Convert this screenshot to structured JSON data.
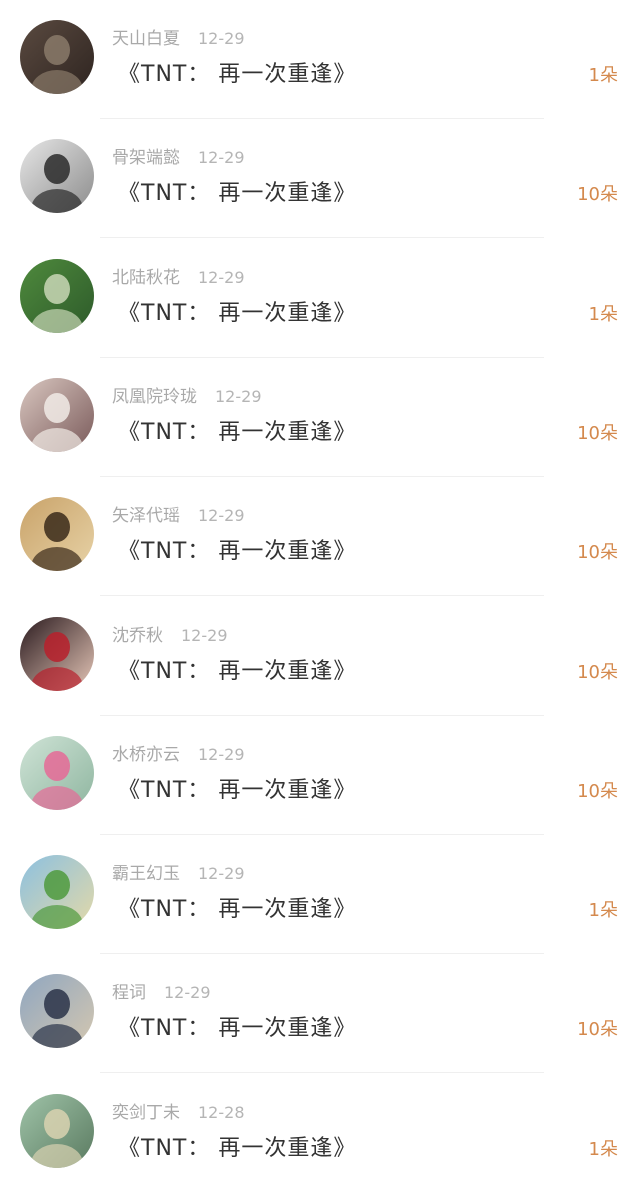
{
  "list": {
    "items": [
      {
        "name": "天山白夏",
        "date": "12-29",
        "title": "《TNT：  再一次重逢》",
        "count": "1朵",
        "avatar_icon": "avatar-dark-portrait",
        "avatar_colors": [
          "#5a4a40",
          "#8a7a6a",
          "#2e2420"
        ]
      },
      {
        "name": "骨架端懿",
        "date": "12-29",
        "title": "《TNT：  再一次重逢》",
        "count": "10朵",
        "avatar_icon": "avatar-bw-portrait",
        "avatar_colors": [
          "#e6e6e6",
          "#2a2a2a",
          "#8c8c8c"
        ]
      },
      {
        "name": "北陆秋花",
        "date": "12-29",
        "title": "《TNT：  再一次重逢》",
        "count": "1朵",
        "avatar_icon": "avatar-green-field",
        "avatar_colors": [
          "#4f8a3d",
          "#c9d7b6",
          "#2d5a2a"
        ]
      },
      {
        "name": "凤凰院玲珑",
        "date": "12-29",
        "title": "《TNT：  再一次重逢》",
        "count": "10朵",
        "avatar_icon": "avatar-light-portrait",
        "avatar_colors": [
          "#d9c7c0",
          "#f1ebe6",
          "#7a5a5a"
        ]
      },
      {
        "name": "矢泽代瑶",
        "date": "12-29",
        "title": "《TNT：  再一次重逢》",
        "count": "10朵",
        "avatar_icon": "avatar-warm-portrait",
        "avatar_colors": [
          "#c9a36a",
          "#3a2a1a",
          "#e7d2a6"
        ]
      },
      {
        "name": "沈乔秋",
        "date": "12-29",
        "title": "《TNT：  再一次重逢》",
        "count": "10朵",
        "avatar_icon": "avatar-red-portrait",
        "avatar_colors": [
          "#2a1a1e",
          "#b8202c",
          "#e6c7b8"
        ]
      },
      {
        "name": "水桥亦云",
        "date": "12-29",
        "title": "《TNT：  再一次重逢》",
        "count": "10朵",
        "avatar_icon": "avatar-flower",
        "avatar_colors": [
          "#cfe3d6",
          "#e56a97",
          "#8fb6a0"
        ]
      },
      {
        "name": "霸王幻玉",
        "date": "12-29",
        "title": "《TNT：  再一次重逢》",
        "count": "1朵",
        "avatar_icon": "avatar-landscape-tree",
        "avatar_colors": [
          "#8cc0e0",
          "#4f9a3d",
          "#e3d9a8"
        ]
      },
      {
        "name": "程词",
        "date": "12-29",
        "title": "《TNT：  再一次重逢》",
        "count": "10朵",
        "avatar_icon": "avatar-city-portrait",
        "avatar_colors": [
          "#8fa6c0",
          "#2a3348",
          "#d4c7b0"
        ]
      },
      {
        "name": "奕剑丁未",
        "date": "12-28",
        "title": "《TNT：  再一次重逢》",
        "count": "1朵",
        "avatar_icon": "avatar-classroom",
        "avatar_colors": [
          "#9fc3a8",
          "#d9d2b0",
          "#5a7a60"
        ]
      }
    ]
  }
}
